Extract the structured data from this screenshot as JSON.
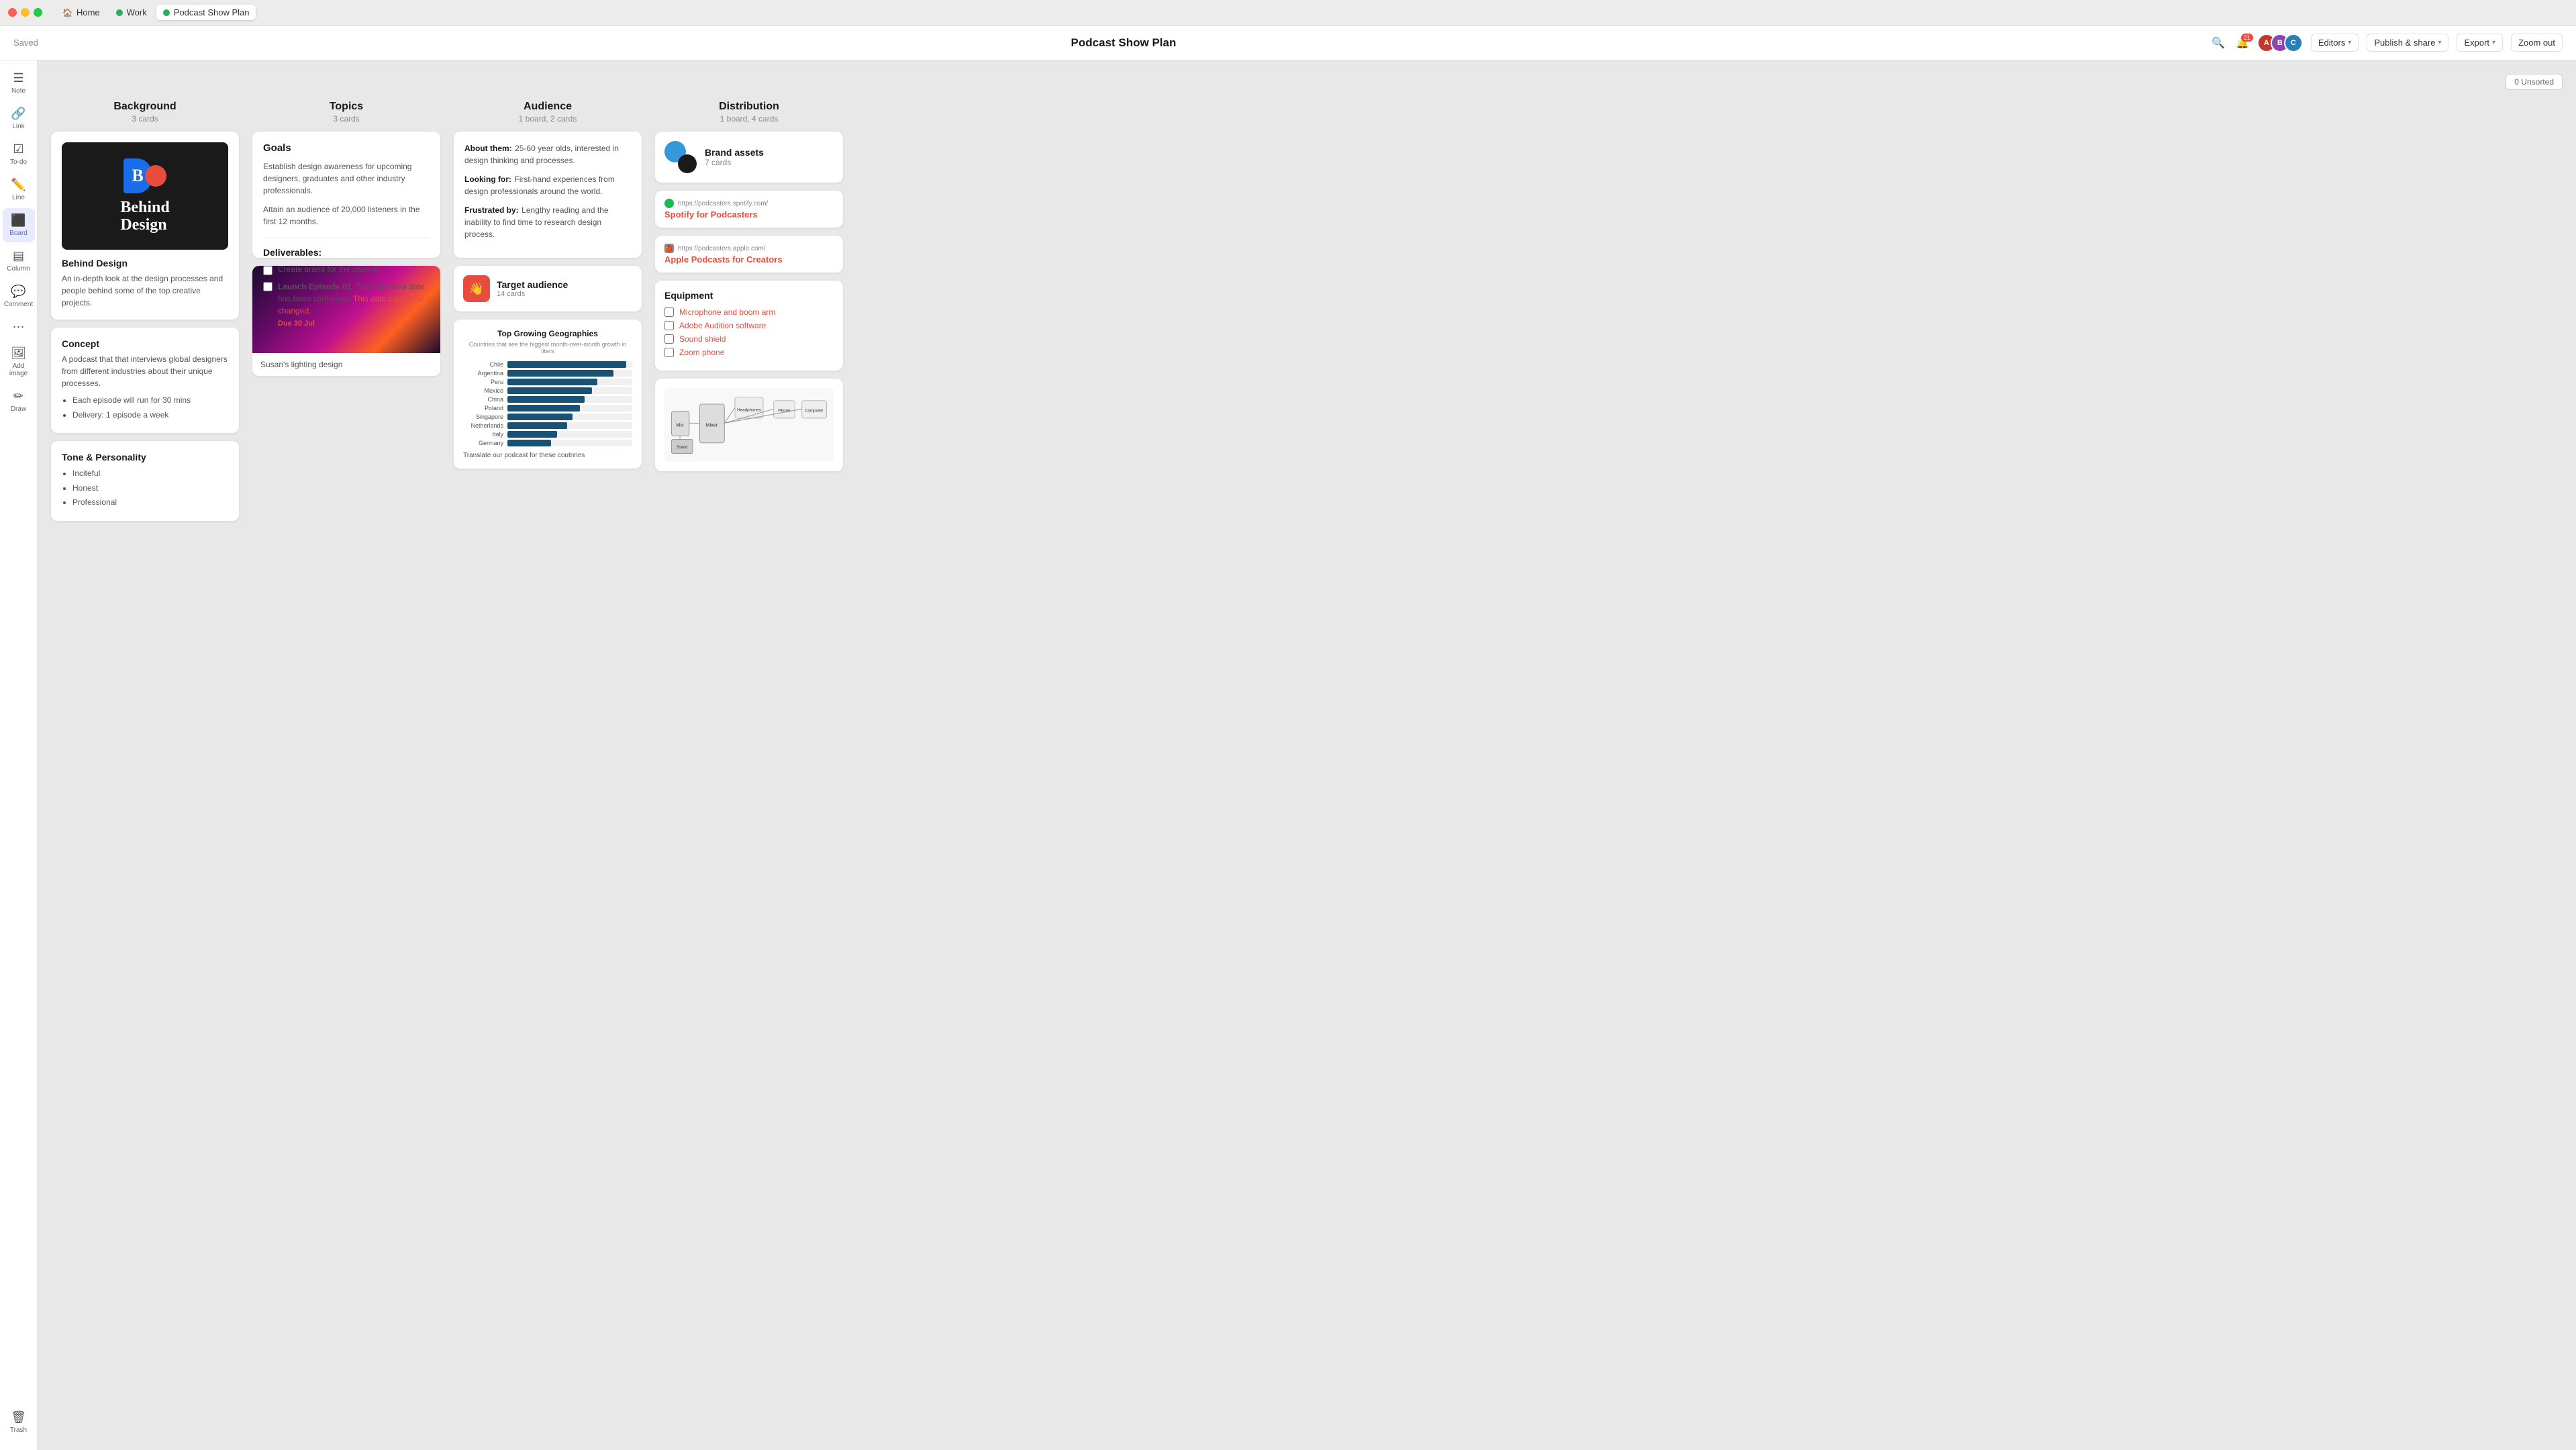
{
  "titlebar": {
    "tabs": [
      {
        "id": "home",
        "label": "Home",
        "icon": "🏠",
        "active": false,
        "dot_color": null
      },
      {
        "id": "work",
        "label": "Work",
        "icon": null,
        "active": false,
        "dot_color": "#27ae60"
      },
      {
        "id": "podcast",
        "label": "Podcast Show Plan",
        "icon": null,
        "active": true,
        "dot_color": "#27ae60"
      }
    ]
  },
  "topbar": {
    "saved_label": "Saved",
    "title": "Podcast Show Plan",
    "editors_label": "Editors",
    "publish_label": "Publish & share",
    "export_label": "Export",
    "zoom_label": "Zoom out",
    "notification_count": "21"
  },
  "sidebar": {
    "items": [
      {
        "id": "note",
        "icon": "☰",
        "label": "Note"
      },
      {
        "id": "link",
        "icon": "🔗",
        "label": "Link"
      },
      {
        "id": "todo",
        "icon": "☑",
        "label": "To-do"
      },
      {
        "id": "line",
        "icon": "✏️",
        "label": "Line"
      },
      {
        "id": "board",
        "icon": "⬛",
        "label": "Board",
        "active": true
      },
      {
        "id": "column",
        "icon": "▤",
        "label": "Column"
      },
      {
        "id": "comment",
        "icon": "💬",
        "label": "Comment"
      },
      {
        "id": "more",
        "icon": "⋯",
        "label": ""
      },
      {
        "id": "add-image",
        "icon": "🖼",
        "label": "Add image"
      },
      {
        "id": "draw",
        "icon": "✏",
        "label": "Draw"
      }
    ],
    "trash_label": "Trash"
  },
  "unsorted_badge": "0 Unsorted",
  "columns": [
    {
      "id": "background",
      "title": "Background",
      "subtitle": "3 cards",
      "cards": [
        {
          "id": "behind-design",
          "type": "logo-card",
          "title": "Behind Design",
          "description": "An in-depth look at the design processes and people behind some of the top creative projects."
        },
        {
          "id": "concept",
          "type": "text-card",
          "title": "Concept",
          "description": "A podcast that that interviews global designers from different industries about their unique processes.",
          "list_items": [
            "Each episode will run for 30 mins",
            "Delivery: 1 episode a week"
          ]
        },
        {
          "id": "tone",
          "type": "text-card",
          "title": "Tone & Personality",
          "list_items": [
            "Inciteful",
            "Honest",
            "Professional"
          ]
        }
      ]
    },
    {
      "id": "topics",
      "title": "Topics",
      "subtitle": "3 cards",
      "cards": [
        {
          "id": "goals",
          "type": "goals-card",
          "title": "Goals",
          "description": "Establish design awareness for upcoming designers, graduates and other industry professionals.",
          "secondary": "Attain an audience of 20,000 listeners in the first 12 months."
        },
        {
          "id": "deliverables",
          "type": "deliverables-card",
          "title": "Deliverables:",
          "items": [
            {
              "text": "Create brand for the channel",
              "checked": false
            },
            {
              "text": "Launch Episode 01",
              "detail": ". Tony interview date has been confirmed.",
              "overdue_text": "This date cannot be changed.",
              "due_label": "Due 30 Jul",
              "checked": false
            }
          ]
        },
        {
          "id": "photo",
          "type": "photo-card",
          "caption": "Susan's lighting design"
        }
      ]
    },
    {
      "id": "audience",
      "title": "Audience",
      "subtitle": "1 board, 2 cards",
      "cards": [
        {
          "id": "audience-info",
          "type": "audience-card",
          "about_label": "About them:",
          "about_text": " 25-60 year olds, interested in design thinking and processes.",
          "looking_label": "Looking for:",
          "looking_text": " First-hand experiences from design professionals around the world.",
          "frustrated_label": "Frustrated by:",
          "frustrated_text": " Lengthy reading and the inability to find time to research design process."
        },
        {
          "id": "target-audience",
          "type": "target-card",
          "title": "Target audience",
          "subtitle": "14 cards",
          "icon": "👋"
        },
        {
          "id": "chart",
          "type": "chart-card",
          "title": "Top Growing Geographies",
          "subtitle": "Countries that see the biggest month-over-month growth in liters",
          "footer": "Translate our podcast for these coutnries",
          "bars": [
            {
              "label": "Chile",
              "value": 95
            },
            {
              "label": "Argentina",
              "value": 85
            },
            {
              "label": "Peru",
              "value": 72
            },
            {
              "label": "Mexico",
              "value": 68
            },
            {
              "label": "China",
              "value": 62
            },
            {
              "label": "Poland",
              "value": 58
            },
            {
              "label": "Singapore",
              "value": 52
            },
            {
              "label": "Netherlands",
              "value": 48
            },
            {
              "label": "Italy",
              "value": 40
            },
            {
              "label": "Germany",
              "value": 35
            }
          ]
        }
      ]
    },
    {
      "id": "distribution",
      "title": "Distribution",
      "subtitle": "1 board, 4 cards",
      "cards": [
        {
          "id": "brand-assets",
          "type": "brand-card",
          "title": "Brand assets",
          "subtitle": "7 cards"
        },
        {
          "id": "spotify-link",
          "type": "link-card",
          "url": "https://podcasters.spotify.com/",
          "link_title": "Spotify for Podcasters",
          "provider": "spotify"
        },
        {
          "id": "apple-link",
          "type": "link-card",
          "url": "https://podcasters.apple.com/",
          "link_title": "Apple Podcasts for Creators",
          "provider": "apple"
        },
        {
          "id": "equipment",
          "type": "equipment-card",
          "title": "Equipment",
          "items": [
            {
              "text": "Microphone and boom arm",
              "checked": false
            },
            {
              "text": "Adobe Audition software",
              "checked": false
            },
            {
              "text": "Sound shield",
              "checked": false
            },
            {
              "text": "Zoom phone",
              "checked": false
            }
          ]
        },
        {
          "id": "diagram",
          "type": "diagram-card"
        }
      ]
    }
  ]
}
